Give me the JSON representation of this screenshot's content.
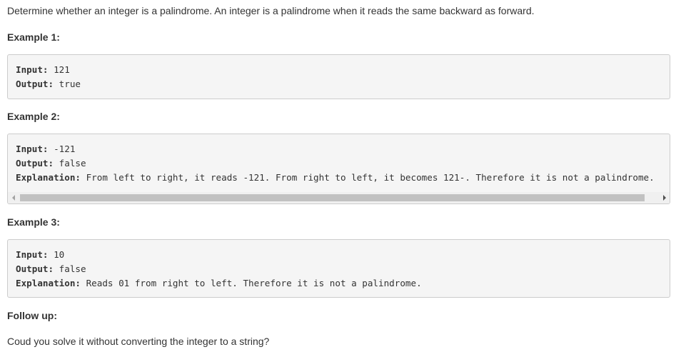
{
  "description": "Determine whether an integer is a palindrome. An integer is a palindrome when it reads the same backward as forward.",
  "examples": [
    {
      "title": "Example 1:",
      "input_label": "Input:",
      "input_value": " 121",
      "output_label": "Output:",
      "output_value": " true"
    },
    {
      "title": "Example 2:",
      "input_label": "Input:",
      "input_value": " -121",
      "output_label": "Output:",
      "output_value": " false",
      "explanation_label": "Explanation:",
      "explanation_value": " From left to right, it reads -121. From right to left, it becomes 121-. Therefore it is not a palindrome."
    },
    {
      "title": "Example 3:",
      "input_label": "Input:",
      "input_value": " 10",
      "output_label": "Output:",
      "output_value": " false",
      "explanation_label": "Explanation:",
      "explanation_value": " Reads 01 from right to left. Therefore it is not a palindrome."
    }
  ],
  "followup": {
    "title": "Follow up:",
    "text": "Coud you solve it without converting the integer to a string?"
  }
}
